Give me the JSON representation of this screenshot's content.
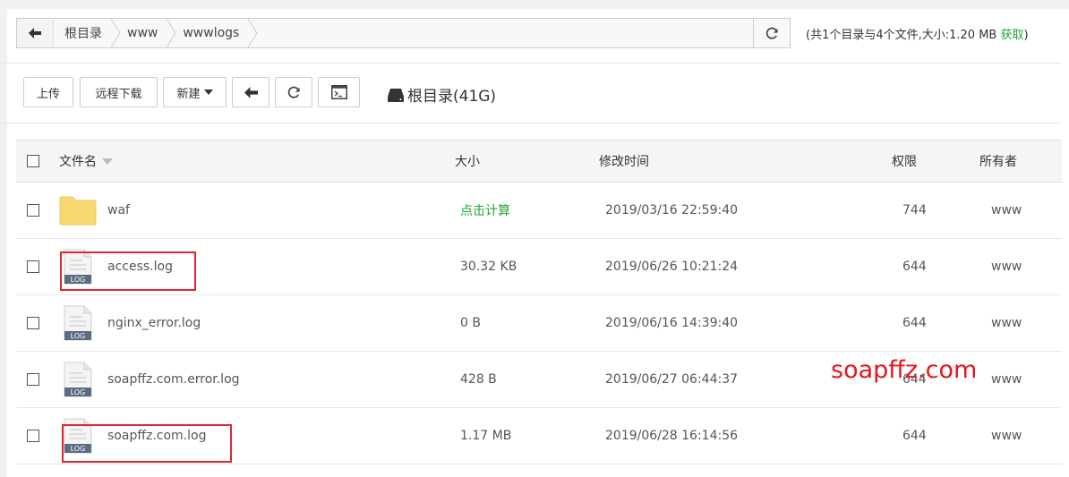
{
  "breadcrumb": {
    "items": [
      "根目录",
      "www",
      "wwwlogs"
    ]
  },
  "summary": {
    "text": "(共1个目录与4个文件,大小:1.20 MB",
    "link": "获取",
    "close": ")"
  },
  "toolbar": {
    "upload": "上传",
    "remote_download": "远程下载",
    "new": "新建"
  },
  "disk": {
    "label": "根目录(41G)"
  },
  "table": {
    "headers": {
      "name": "文件名",
      "size": "大小",
      "mtime": "修改时间",
      "perm": "权限",
      "owner": "所有者"
    },
    "rows": [
      {
        "type": "folder",
        "name": "waf",
        "size": "点击计算",
        "mtime": "2019/03/16 22:59:40",
        "perm": "744",
        "owner": "www"
      },
      {
        "type": "log",
        "name": "access.log",
        "size": "30.32 KB",
        "mtime": "2019/06/26 10:21:24",
        "perm": "644",
        "owner": "www"
      },
      {
        "type": "log",
        "name": "nginx_error.log",
        "size": "0 B",
        "mtime": "2019/06/16 14:39:40",
        "perm": "644",
        "owner": "www"
      },
      {
        "type": "log",
        "name": "soapffz.com.error.log",
        "size": "428 B",
        "mtime": "2019/06/27 06:44:37",
        "perm": "644",
        "owner": "www"
      },
      {
        "type": "log",
        "name": "soapffz.com.log",
        "size": "1.17 MB",
        "mtime": "2019/06/28 16:14:56",
        "perm": "644",
        "owner": "www"
      }
    ]
  },
  "file_icon_label": "LOG",
  "watermark": "soapffz.com",
  "colors": {
    "accent": "#20a53a",
    "highlight": "#e0262c",
    "folder": "#f7d872"
  }
}
